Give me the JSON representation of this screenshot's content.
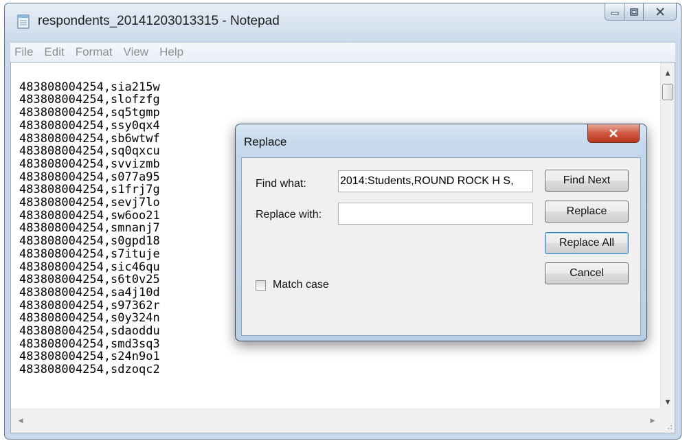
{
  "window": {
    "title": "respondents_20141203013315 - Notepad",
    "icon": "notepad-icon"
  },
  "menu": [
    "File",
    "Edit",
    "Format",
    "View",
    "Help"
  ],
  "lines": [
    "483808004254,sia215w",
    "483808004254,slofzfg",
    "483808004254,sq5tgmp",
    "483808004254,ssy0qx4",
    "483808004254,sb6wtwf",
    "483808004254,sq0qxcu",
    "483808004254,svvizmb",
    "483808004254,s077a95",
    "483808004254,s1frj7g",
    "483808004254,sevj7lo",
    "483808004254,sw6oo21",
    "483808004254,smnanj7",
    "483808004254,s0gpd18",
    "483808004254,s7ituje",
    "483808004254,sic46qu",
    "483808004254,s6t0v25",
    "483808004254,sa4j10d",
    "483808004254,s97362r",
    "483808004254,s0y324n",
    "483808004254,sdaoddu",
    "483808004254,smd3sq3",
    "483808004254,s24n9o1",
    "483808004254,sdzoqc2"
  ],
  "dialog": {
    "title": "Replace",
    "find_label": "Find what:",
    "find_value": "2014:Students,ROUND ROCK H S,",
    "replace_label": "Replace with:",
    "replace_value": "",
    "match_case_label": "Match case",
    "match_case_checked": false,
    "buttons": {
      "find_next": "Find Next",
      "replace": "Replace",
      "replace_all": "Replace All",
      "cancel": "Cancel"
    }
  },
  "colors": {
    "close_button": "#c8412a",
    "title_bar": "#c9d9ea"
  }
}
